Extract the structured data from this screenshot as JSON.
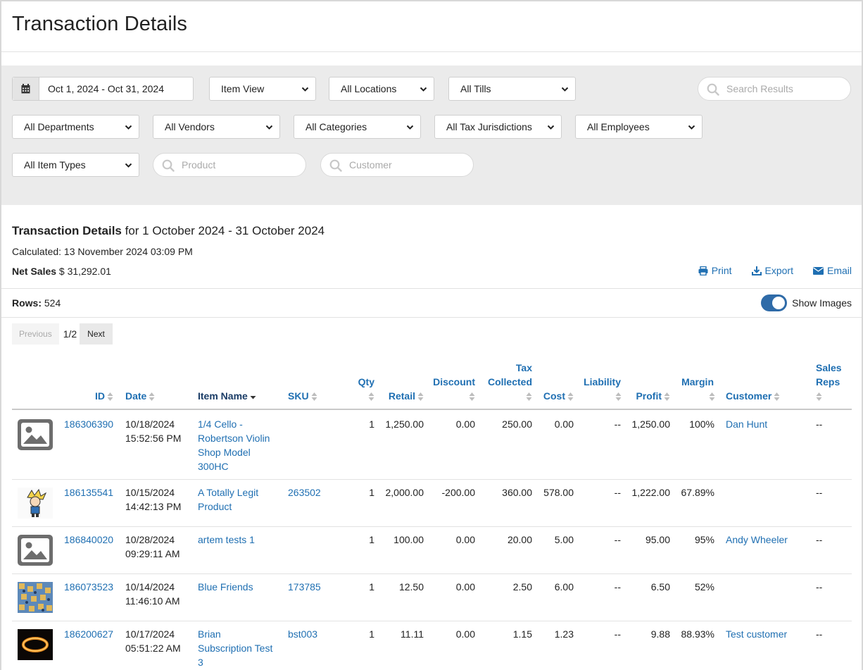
{
  "page_title": "Transaction Details",
  "filters": {
    "date_range": "Oct 1, 2024 - Oct 31, 2024",
    "view": "Item View",
    "locations": "All Locations",
    "tills": "All Tills",
    "search_placeholder": "Search Results",
    "departments": "All Departments",
    "vendors": "All Vendors",
    "categories": "All Categories",
    "tax_jurisdictions": "All Tax Jurisdictions",
    "employees": "All Employees",
    "item_types": "All Item Types",
    "product_placeholder": "Product",
    "customer_placeholder": "Customer"
  },
  "report": {
    "title_bold": "Transaction Details",
    "title_rest": " for 1 October 2024 - 31 October 2024",
    "calculated": "Calculated: 13 November 2024 03:09 PM",
    "net_sales_label": "Net Sales",
    "net_sales_value": " $ 31,292.01",
    "rows_label": "Rows:",
    "rows_value": " 524",
    "show_images_label": "Show Images",
    "show_images_on": true
  },
  "actions": {
    "print": "Print",
    "export": "Export",
    "email": "Email"
  },
  "pager": {
    "previous": "Previous",
    "page": "1/2",
    "next": "Next"
  },
  "columns": {
    "id": "ID",
    "date": "Date",
    "item_name": "Item Name",
    "sku": "SKU",
    "qty": "Qty",
    "retail": "Retail",
    "discount": "Discount",
    "tax_line1": "Tax",
    "tax_line2": "Collected",
    "cost": "Cost",
    "liability": "Liability",
    "profit": "Profit",
    "margin": "Margin",
    "customer": "Customer",
    "reps_line1": "Sales",
    "reps_line2": "Reps"
  },
  "rows": [
    {
      "image": "placeholder",
      "id": "186306390",
      "date": "10/18/2024",
      "time": "15:52:56 PM",
      "item_lines": [
        "1/4 Cello -",
        "Robertson Violin",
        "Shop Model",
        "300HC"
      ],
      "sku": "",
      "qty": "1",
      "retail": "1,250.00",
      "discount": "0.00",
      "tax": "250.00",
      "cost": "0.00",
      "liability": "--",
      "profit": "1,250.00",
      "margin": "100%",
      "customer": "Dan Hunt",
      "reps": "--"
    },
    {
      "image": "cartoon",
      "id": "186135541",
      "date": "10/15/2024",
      "time": "14:42:13 PM",
      "item_lines": [
        "A Totally Legit",
        "Product"
      ],
      "sku": "263502",
      "qty": "1",
      "retail": "2,000.00",
      "discount": "-200.00",
      "tax": "360.00",
      "cost": "578.00",
      "liability": "--",
      "profit": "1,222.00",
      "margin": "67.89%",
      "customer": "",
      "reps": "--"
    },
    {
      "image": "placeholder",
      "id": "186840020",
      "date": "10/28/2024",
      "time": "09:29:11 AM",
      "item_lines": [
        "artem tests 1"
      ],
      "sku": "",
      "qty": "1",
      "retail": "100.00",
      "discount": "0.00",
      "tax": "20.00",
      "cost": "5.00",
      "liability": "--",
      "profit": "95.00",
      "margin": "95%",
      "customer": "Andy Wheeler",
      "reps": "--"
    },
    {
      "image": "pattern",
      "id": "186073523",
      "date": "10/14/2024",
      "time": "11:46:10 AM",
      "item_lines": [
        "Blue Friends"
      ],
      "sku": "173785",
      "qty": "1",
      "retail": "12.50",
      "discount": "0.00",
      "tax": "2.50",
      "cost": "6.00",
      "liability": "--",
      "profit": "6.50",
      "margin": "52%",
      "customer": "",
      "reps": "--"
    },
    {
      "image": "ring",
      "id": "186200627",
      "date": "10/17/2024",
      "time": "05:51:22 AM",
      "item_lines": [
        "Brian",
        "Subscription Test",
        "3"
      ],
      "sku": "bst003",
      "qty": "1",
      "retail": "11.11",
      "discount": "0.00",
      "tax": "1.15",
      "cost": "1.23",
      "liability": "--",
      "profit": "9.88",
      "margin": "88.93%",
      "customer": "Test customer",
      "reps": "--"
    }
  ],
  "colors": {
    "link": "#1f6fb2",
    "filter_bg": "#ebebeb",
    "toggle": "#2f6ba8"
  }
}
